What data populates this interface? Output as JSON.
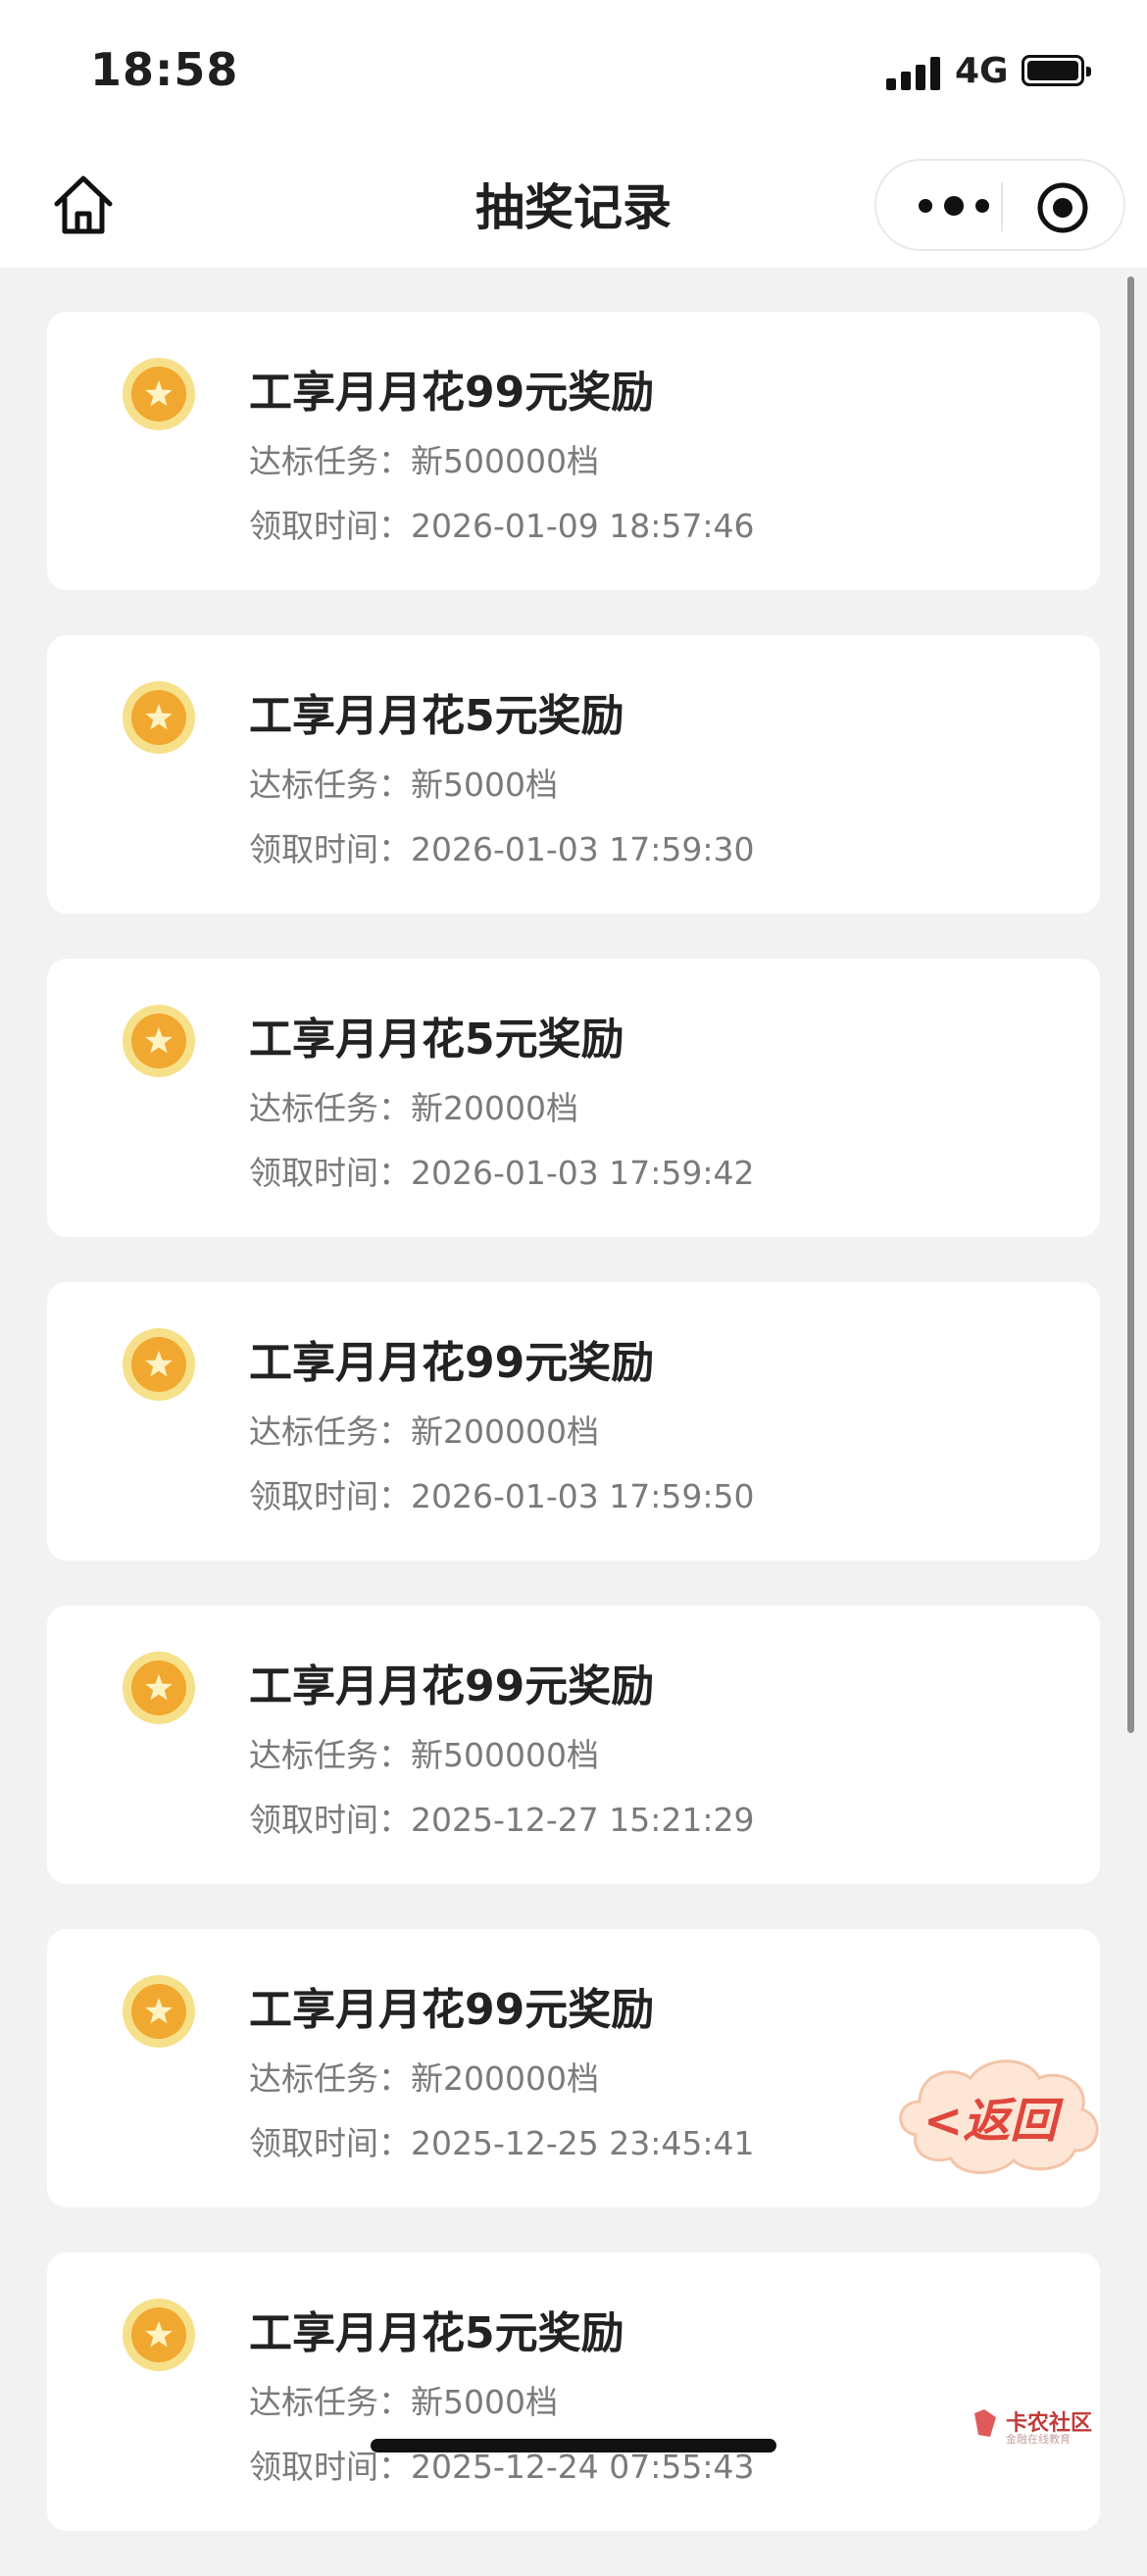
{
  "status_bar": {
    "time": "18:58",
    "network": "4G"
  },
  "nav": {
    "title": "抽奖记录"
  },
  "records": [
    {
      "name": "工享月月花99元奖励",
      "task_label": "达标任务：",
      "task": "新500000档",
      "time_label": "领取时间：",
      "time": "2026-01-09 18:57:46"
    },
    {
      "name": "工享月月花5元奖励",
      "task_label": "达标任务：",
      "task": "新5000档",
      "time_label": "领取时间：",
      "time": "2026-01-03 17:59:30"
    },
    {
      "name": "工享月月花5元奖励",
      "task_label": "达标任务：",
      "task": "新20000档",
      "time_label": "领取时间：",
      "time": "2026-01-03 17:59:42"
    },
    {
      "name": "工享月月花99元奖励",
      "task_label": "达标任务：",
      "task": "新200000档",
      "time_label": "领取时间：",
      "time": "2026-01-03 17:59:50"
    },
    {
      "name": "工享月月花99元奖励",
      "task_label": "达标任务：",
      "task": "新500000档",
      "time_label": "领取时间：",
      "time": "2025-12-27 15:21:29"
    },
    {
      "name": "工享月月花99元奖励",
      "task_label": "达标任务：",
      "task": "新200000档",
      "time_label": "领取时间：",
      "time": "2025-12-25 23:45:41"
    },
    {
      "name": "工享月月花5元奖励",
      "task_label": "达标任务：",
      "task": "新5000档",
      "time_label": "领取时间：",
      "time": "2025-12-24 07:55:43"
    }
  ],
  "floating_back": {
    "label": "<返回"
  },
  "watermark": {
    "text": "卡农社区",
    "subtext": "金融在线教育"
  },
  "icons": {
    "home": "home-icon",
    "more": "more-dots-icon",
    "close": "miniprogram-close-icon",
    "reward": "star-coin-icon"
  },
  "colors": {
    "coin_outer": "#f7e08a",
    "coin_inner": "#f0a830",
    "back_text": "#e0463c"
  }
}
